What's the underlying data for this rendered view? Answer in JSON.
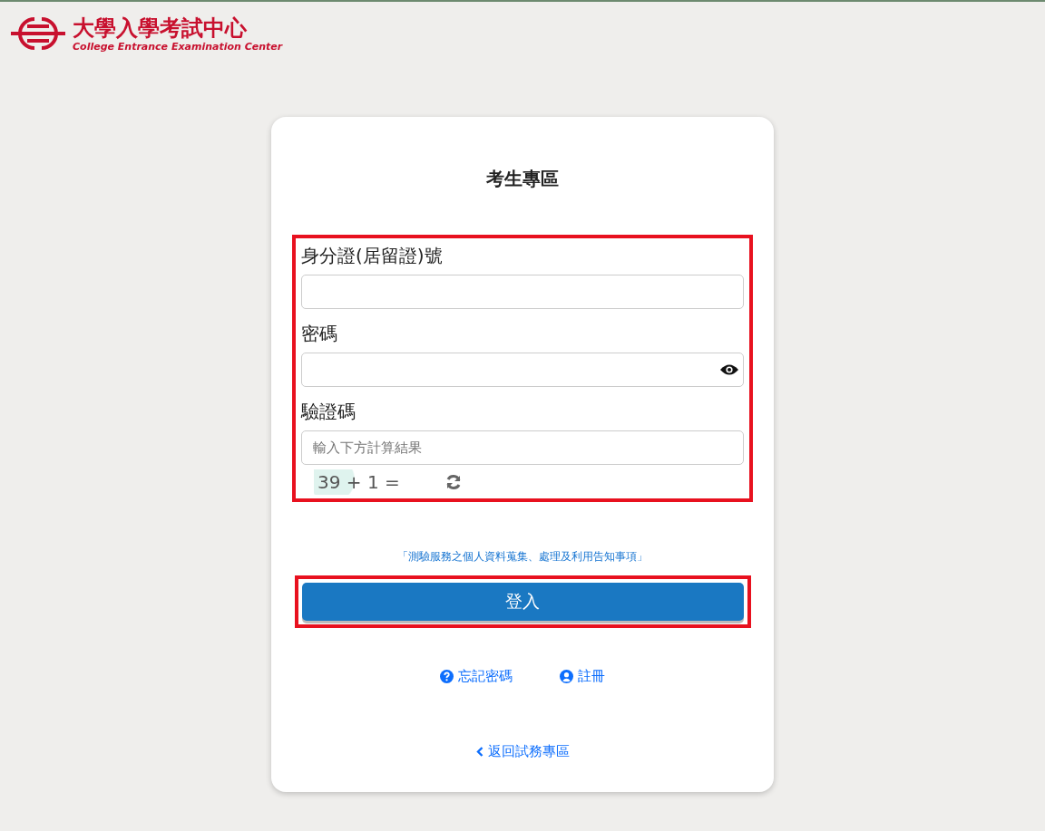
{
  "header": {
    "logo_title": "大學入學考試中心",
    "logo_subtitle": "College Entrance Examination Center"
  },
  "card": {
    "title": "考生專區",
    "fields": [
      {
        "kind": "text",
        "label": "身分證(居留證)號"
      },
      {
        "kind": "password",
        "label": "密碼"
      },
      {
        "kind": "captcha",
        "label": "驗證碼",
        "placeholder": "輸入下方計算結果",
        "captcha": "39 + 1 ="
      }
    ],
    "privacy_link": "「測驗服務之個人資料蒐集、處理及利用告知事項」",
    "login_button": "登入",
    "links": [
      {
        "kind": "help",
        "label": "忘記密碼"
      },
      {
        "kind": "user",
        "label": "註冊"
      }
    ],
    "back_link": "返回試務專區"
  }
}
